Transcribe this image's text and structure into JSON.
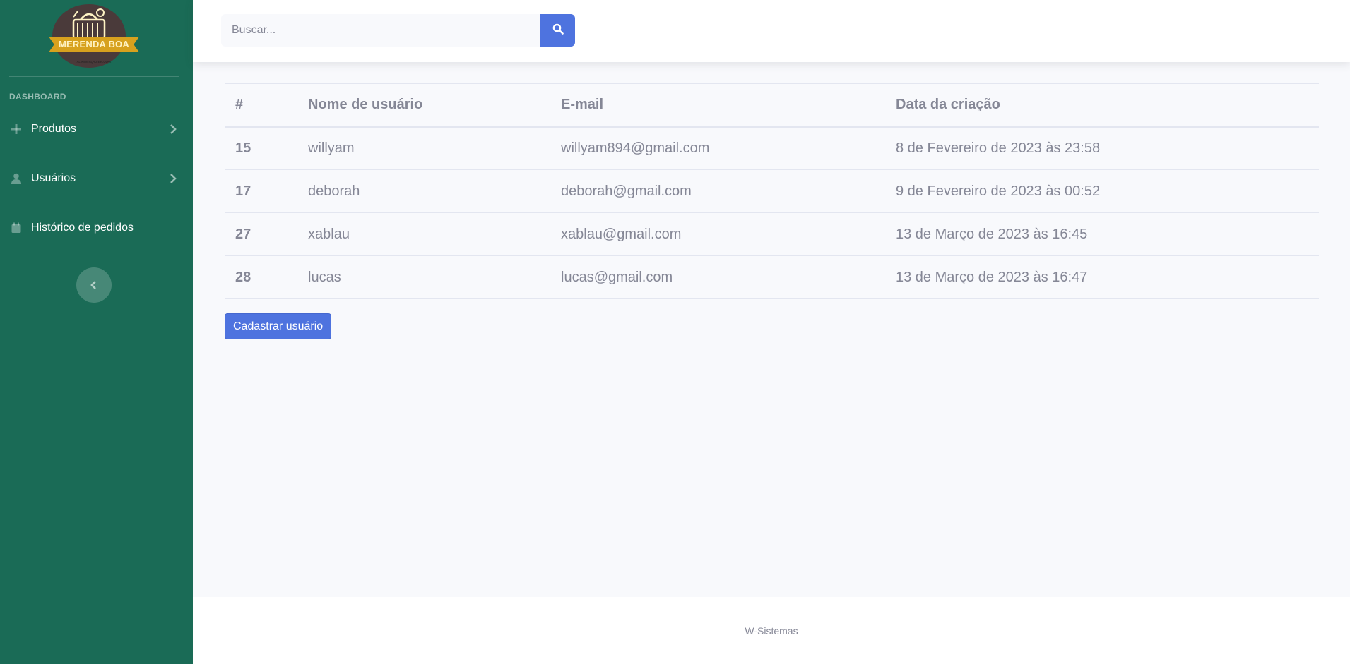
{
  "sidebar": {
    "brand": {
      "logo_text": "MERENDA BOA",
      "logo_tagline": "ALIMENTAÇÃO ESCOLAR"
    },
    "section_heading": "DASHBOARD",
    "items": [
      {
        "label": "Produtos",
        "icon": "plus-icon",
        "has_submenu": true
      },
      {
        "label": "Usuários",
        "icon": "user-icon",
        "has_submenu": true
      },
      {
        "label": "Histórico de pedidos",
        "icon": "calendar-icon",
        "has_submenu": false
      }
    ],
    "toggle_icon": "chevron-left-icon",
    "color": "#1a6b56"
  },
  "topbar": {
    "search": {
      "placeholder": "Buscar...",
      "value": "",
      "button_icon": "search-icon"
    },
    "accent_color": "#4e73df"
  },
  "table": {
    "columns": [
      "#",
      "Nome de usuário",
      "E-mail",
      "Data da criação"
    ],
    "rows": [
      {
        "id": "15",
        "name": "willyam",
        "email": "willyam894@gmail.com",
        "created": "8 de Fevereiro de 2023 às 23:58"
      },
      {
        "id": "17",
        "name": "deborah",
        "email": "deborah@gmail.com",
        "created": "9 de Fevereiro de 2023 às 00:52"
      },
      {
        "id": "27",
        "name": "xablau",
        "email": "xablau@gmail.com",
        "created": "13 de Março de 2023 às 16:45"
      },
      {
        "id": "28",
        "name": "lucas",
        "email": "lucas@gmail.com",
        "created": "13 de Março de 2023 às 16:47"
      }
    ]
  },
  "actions": {
    "add_user_label": "Cadastrar usuário"
  },
  "footer": {
    "text": "W-Sistemas"
  }
}
